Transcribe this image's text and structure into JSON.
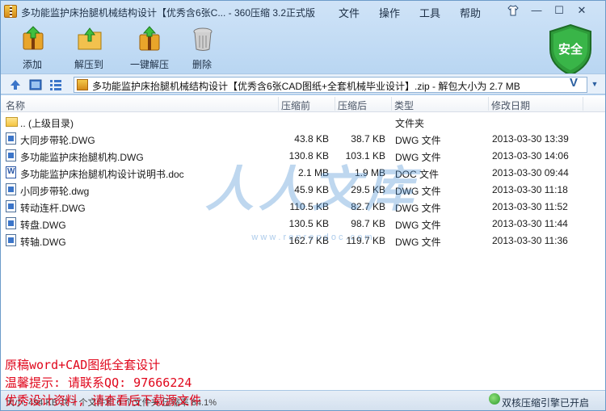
{
  "window": {
    "title": "多功能监护床抬腿机械结构设计【优秀含6张C... - 360压缩 3.2正式版",
    "menu": [
      "文件",
      "操作",
      "工具",
      "帮助"
    ]
  },
  "toolbar": {
    "buttons": [
      {
        "label": "添加",
        "icon": "add-archive-icon"
      },
      {
        "label": "解压到",
        "icon": "extract-to-icon"
      },
      {
        "label": "一键解压",
        "icon": "one-click-extract-icon"
      },
      {
        "label": "删除",
        "icon": "trash-icon"
      }
    ],
    "shield_label": "安全"
  },
  "address": {
    "path": "多功能监护床抬腿机械结构设计【优秀含6张CAD图纸+全套机械毕业设计】.zip - 解包大小为 2.7 MB",
    "v_label": "V"
  },
  "columns": [
    "名称",
    "压缩前",
    "压缩后",
    "类型",
    "修改日期"
  ],
  "rows": [
    {
      "name": ".. (上级目录)",
      "before": "",
      "after": "",
      "type": "文件夹",
      "date": "",
      "icon": "folder"
    },
    {
      "name": "大同步带轮.DWG",
      "before": "43.8 KB",
      "after": "38.7 KB",
      "type": "DWG 文件",
      "date": "2013-03-30 13:39",
      "icon": "dwg"
    },
    {
      "name": "多功能监护床抬腿机构.DWG",
      "before": "130.8 KB",
      "after": "103.1 KB",
      "type": "DWG 文件",
      "date": "2013-03-30 14:06",
      "icon": "dwg"
    },
    {
      "name": "多功能监护床抬腿机构设计说明书.doc",
      "before": "2.1 MB",
      "after": "1.9 MB",
      "type": "DOC 文件",
      "date": "2013-03-30 09:44",
      "icon": "doc"
    },
    {
      "name": "小同步带轮.dwg",
      "before": "45.9 KB",
      "after": "29.5 KB",
      "type": "DWG 文件",
      "date": "2013-03-30 11:18",
      "icon": "dwg"
    },
    {
      "name": "转动连杆.DWG",
      "before": "110.5 KB",
      "after": "82.7 KB",
      "type": "DWG 文件",
      "date": "2013-03-30 11:52",
      "icon": "dwg"
    },
    {
      "name": "转盘.DWG",
      "before": "130.5 KB",
      "after": "98.7 KB",
      "type": "DWG 文件",
      "date": "2013-03-30 11:44",
      "icon": "dwg"
    },
    {
      "name": "转轴.DWG",
      "before": "162.7 KB",
      "after": "119.7 KB",
      "type": "DWG 文件",
      "date": "2013-03-30 11:36",
      "icon": "dwg"
    }
  ],
  "watermark": {
    "chars": "人人文库",
    "url": "w w w . r e n r e n d o c . c o m"
  },
  "status": {
    "left": "大小: 494 KB 共 7 个文件和 0 个文件夹 压缩率 84.1%",
    "right": "双核压缩引擎已开启"
  },
  "overlay": {
    "line1": "原稿word+CAD图纸全套设计",
    "line2": "温馨提示: 请联系QQ: 97666224",
    "line3": "优秀设计资料, 请查看后下载源文件"
  },
  "colors": {
    "accent": "#3b75c9",
    "overlay_text": "#e0061b",
    "shield_green": "#2e9b3a"
  }
}
